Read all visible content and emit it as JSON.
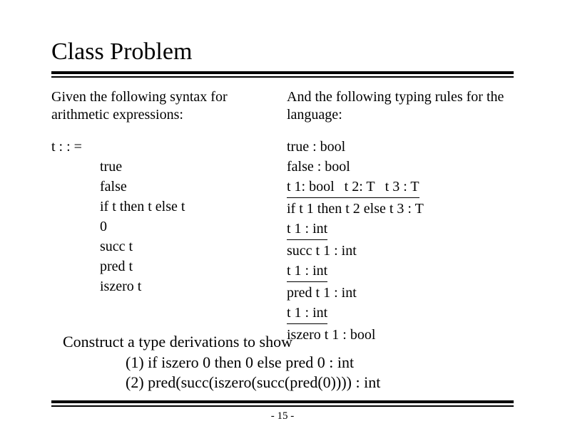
{
  "title": "Class Problem",
  "intro_left": "Given the following syntax for arithmetic expressions:",
  "intro_right": "And the following typing rules for the language:",
  "syntax_head": "t : : =",
  "syntax_lines": {
    "l1": "true",
    "l2": "false",
    "l3": "if t then t else t",
    "l4": "0",
    "l5": "succ t",
    "l6": "pred t",
    "l7": "iszero t"
  },
  "rules": {
    "r1": "true : bool",
    "r2": "false : bool",
    "r3p1": "t 1: bool",
    "r3p2": "t 2: T",
    "r3p3": "t 3 : T",
    "r3c": "if t 1 then t 2 else t 3 : T",
    "r4p": "t 1 : int",
    "r4c": "succ t 1 : int",
    "r5p": "t 1 : int",
    "r5c": "pred t 1 : int",
    "r6p": "t 1 : int",
    "r6c": "iszero t 1 : bool"
  },
  "construct": {
    "head": "Construct a type derivations to show",
    "line1": "(1) if iszero 0 then 0 else pred 0 : int",
    "line2": "(2) pred(succ(iszero(succ(pred(0)))) : int"
  },
  "page_number": "- 15 -"
}
